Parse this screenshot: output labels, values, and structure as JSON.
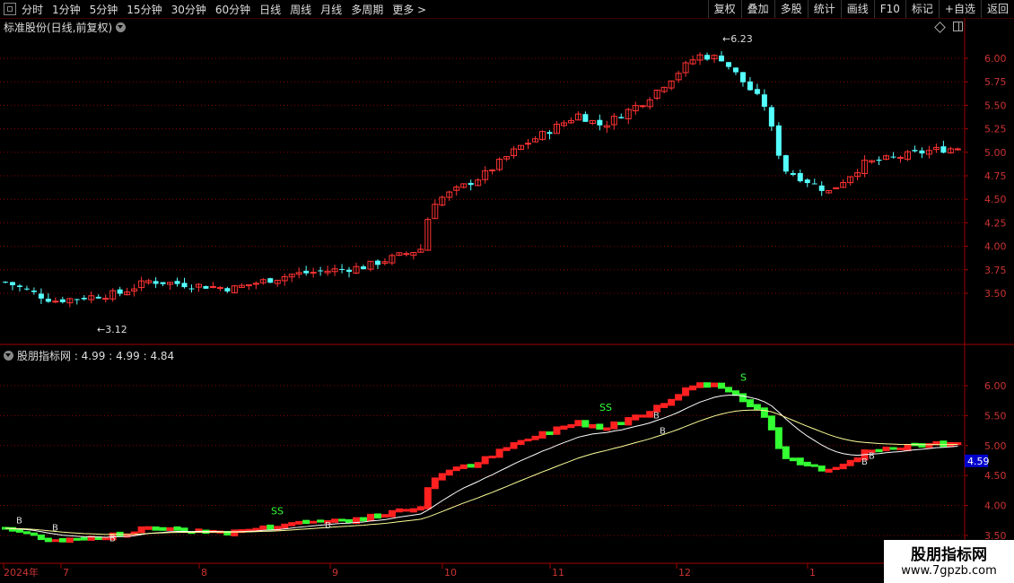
{
  "toolbar": {
    "periods": [
      "分时",
      "1分钟",
      "5分钟",
      "15分钟",
      "30分钟",
      "60分钟",
      "日线",
      "周线",
      "月线",
      "多周期",
      "更多 >"
    ],
    "right_buttons": [
      "复权",
      "叠加",
      "多股",
      "统计",
      "画线",
      "F10",
      "标记",
      "+自选",
      "返回"
    ]
  },
  "main_chart": {
    "title": "标准股份(日线,前复权)",
    "high_label": "6.23",
    "low_label": "3.12",
    "y_ticks": [
      "6.00",
      "5.75",
      "5.50",
      "5.25",
      "5.00",
      "4.75",
      "4.50",
      "4.25",
      "4.00",
      "3.75",
      "3.50"
    ]
  },
  "indicator": {
    "title": "股朋指标网 : 4.99 : 4.99 : 4.84",
    "y_ticks": [
      "6.00",
      "5.50",
      "5.00",
      "4.50",
      "4.00",
      "3.50"
    ],
    "current_value": "4.59",
    "signals": [
      "SS",
      "SS",
      "S",
      "B"
    ]
  },
  "x_axis": {
    "labels": [
      "2024年",
      "7",
      "8",
      "9",
      "10",
      "11",
      "12",
      "1"
    ]
  },
  "watermark": {
    "title": "股朋指标网",
    "url": "www.7gpzb.com"
  },
  "colors": {
    "up": "#ff3333",
    "down": "#54ffff",
    "ind_up": "#ff2020",
    "ind_down": "#33ff33",
    "grid": "#8a0000",
    "ma_slow": "#ffff99",
    "ma_fast": "#ffffff"
  }
}
